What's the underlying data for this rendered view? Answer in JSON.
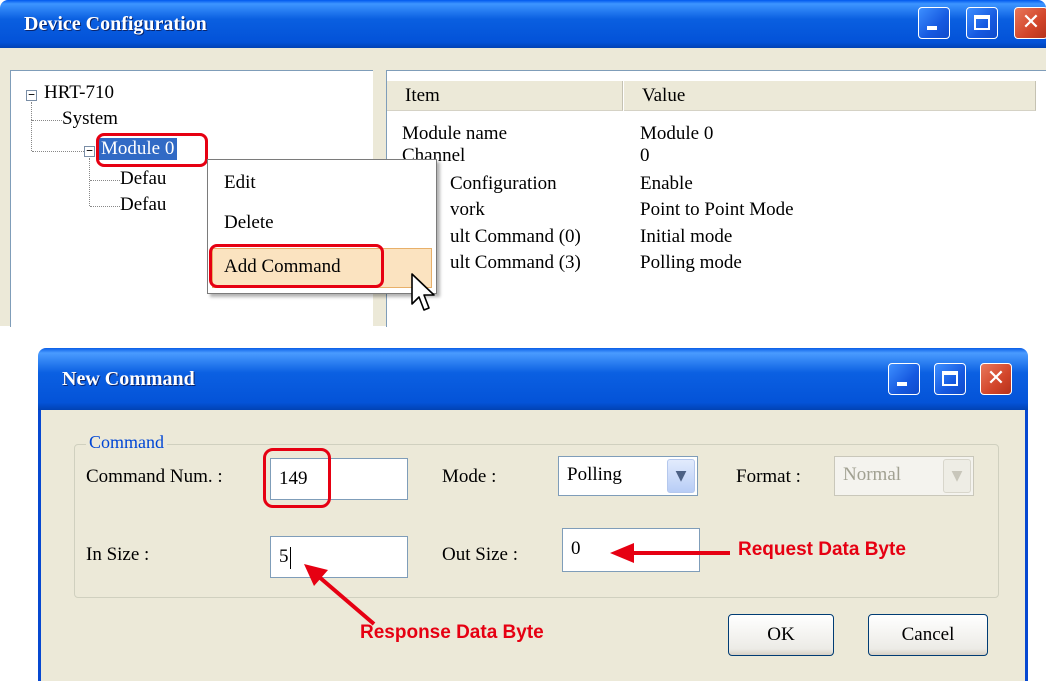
{
  "device_window": {
    "title": "Device Configuration",
    "tree": {
      "root": "HRT-710",
      "system": "System",
      "module": "Module 0",
      "child1": "Defau",
      "child2": "Defau"
    },
    "list": {
      "headers": {
        "item": "Item",
        "value": "Value"
      },
      "rows": [
        {
          "item": "Module name",
          "value": "Module 0"
        },
        {
          "item": "Channel",
          "value": "0"
        },
        {
          "item": "Configuration",
          "value": "Enable"
        },
        {
          "item": "vork",
          "value": "Point to Point Mode"
        },
        {
          "item": "ult Command (0)",
          "value": "Initial mode"
        },
        {
          "item": "ult Command (3)",
          "value": "Polling mode"
        }
      ]
    },
    "context_menu": {
      "items": [
        "Edit",
        "Delete",
        "Add Command"
      ]
    }
  },
  "new_command_dialog": {
    "title": "New Command",
    "group_label": "Command",
    "command_num_label": "Command Num. :",
    "command_num_value": "149",
    "mode_label": "Mode :",
    "mode_value": "Polling",
    "format_label": "Format :",
    "format_value": "Normal",
    "in_size_label": "In Size :",
    "in_size_value": "5",
    "out_size_label": "Out Size :",
    "out_size_value": "0",
    "ok_label": "OK",
    "cancel_label": "Cancel"
  },
  "annotations": {
    "request": "Request Data Byte",
    "response": "Response Data Byte"
  },
  "colors": {
    "title_bar": "#0a5fe0",
    "highlight": "#e60012",
    "dialog_bg": "#ece9d8"
  }
}
